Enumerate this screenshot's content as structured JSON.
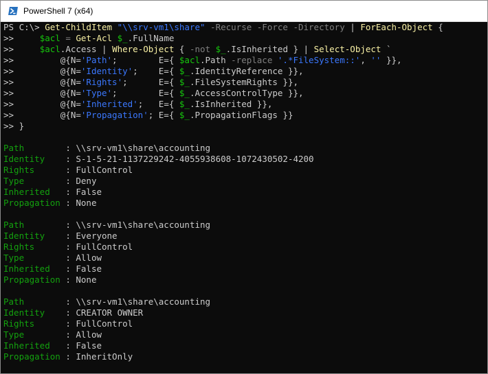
{
  "window": {
    "title": "PowerShell 7 (x64)"
  },
  "icons": {
    "app": "powershell-icon"
  },
  "colors": {
    "background": "#0c0c0c",
    "text": "#cccccc",
    "command": "#f9f1a5",
    "string": "#3b78ff",
    "variable": "#16c60c",
    "parameter": "#808080",
    "label": "#13a10e"
  },
  "command_lines": [
    [
      {
        "t": "PS C:\\> ",
        "c": "default"
      },
      {
        "t": "Get-ChildItem ",
        "c": "cmd"
      },
      {
        "t": "\"\\\\srv-vm1\\share\" ",
        "c": "str"
      },
      {
        "t": "-Recurse -Force -Directory ",
        "c": "param"
      },
      {
        "t": "| ",
        "c": "default"
      },
      {
        "t": "ForEach-Object ",
        "c": "cmd"
      },
      {
        "t": "{",
        "c": "default"
      }
    ],
    [
      {
        "t": ">>     ",
        "c": "default"
      },
      {
        "t": "$acl",
        "c": "var"
      },
      {
        "t": " = ",
        "c": "op"
      },
      {
        "t": "Get-Acl ",
        "c": "cmd"
      },
      {
        "t": "$_",
        "c": "var"
      },
      {
        "t": ".FullName",
        "c": "default"
      }
    ],
    [
      {
        "t": ">>     ",
        "c": "default"
      },
      {
        "t": "$acl",
        "c": "var"
      },
      {
        "t": ".Access | ",
        "c": "default"
      },
      {
        "t": "Where-Object ",
        "c": "cmd"
      },
      {
        "t": "{ ",
        "c": "default"
      },
      {
        "t": "-not ",
        "c": "param"
      },
      {
        "t": "$_",
        "c": "var"
      },
      {
        "t": ".IsInherited } | ",
        "c": "default"
      },
      {
        "t": "Select-Object ",
        "c": "cmd"
      },
      {
        "t": "`",
        "c": "default"
      }
    ],
    [
      {
        "t": ">>         @{N=",
        "c": "default"
      },
      {
        "t": "'Path'",
        "c": "str"
      },
      {
        "t": ";        E={ ",
        "c": "default"
      },
      {
        "t": "$acl",
        "c": "var"
      },
      {
        "t": ".Path ",
        "c": "default"
      },
      {
        "t": "-replace ",
        "c": "param"
      },
      {
        "t": "'.*FileSystem::'",
        "c": "str"
      },
      {
        "t": ", ",
        "c": "default"
      },
      {
        "t": "''",
        "c": "str"
      },
      {
        "t": " }},",
        "c": "default"
      }
    ],
    [
      {
        "t": ">>         @{N=",
        "c": "default"
      },
      {
        "t": "'Identity'",
        "c": "str"
      },
      {
        "t": ";    E={ ",
        "c": "default"
      },
      {
        "t": "$_",
        "c": "var"
      },
      {
        "t": ".IdentityReference }},",
        "c": "default"
      }
    ],
    [
      {
        "t": ">>         @{N=",
        "c": "default"
      },
      {
        "t": "'Rights'",
        "c": "str"
      },
      {
        "t": ";      E={ ",
        "c": "default"
      },
      {
        "t": "$_",
        "c": "var"
      },
      {
        "t": ".FileSystemRights }},",
        "c": "default"
      }
    ],
    [
      {
        "t": ">>         @{N=",
        "c": "default"
      },
      {
        "t": "'Type'",
        "c": "str"
      },
      {
        "t": ";        E={ ",
        "c": "default"
      },
      {
        "t": "$_",
        "c": "var"
      },
      {
        "t": ".AccessControlType }},",
        "c": "default"
      }
    ],
    [
      {
        "t": ">>         @{N=",
        "c": "default"
      },
      {
        "t": "'Inherited'",
        "c": "str"
      },
      {
        "t": ";   E={ ",
        "c": "default"
      },
      {
        "t": "$_",
        "c": "var"
      },
      {
        "t": ".IsInherited }},",
        "c": "default"
      }
    ],
    [
      {
        "t": ">>         @{N=",
        "c": "default"
      },
      {
        "t": "'Propagation'",
        "c": "str"
      },
      {
        "t": "; E={ ",
        "c": "default"
      },
      {
        "t": "$_",
        "c": "var"
      },
      {
        "t": ".PropagationFlags }}",
        "c": "default"
      }
    ],
    [
      {
        "t": ">> }",
        "c": "default"
      }
    ]
  ],
  "output_records": [
    [
      {
        "label": "Path",
        "value": "\\\\srv-vm1\\share\\accounting"
      },
      {
        "label": "Identity",
        "value": "S-1-5-21-1137229242-4055938608-1072430502-4200"
      },
      {
        "label": "Rights",
        "value": "FullControl"
      },
      {
        "label": "Type",
        "value": "Deny"
      },
      {
        "label": "Inherited",
        "value": "False"
      },
      {
        "label": "Propagation",
        "value": "None"
      }
    ],
    [
      {
        "label": "Path",
        "value": "\\\\srv-vm1\\share\\accounting"
      },
      {
        "label": "Identity",
        "value": "Everyone"
      },
      {
        "label": "Rights",
        "value": "FullControl"
      },
      {
        "label": "Type",
        "value": "Allow"
      },
      {
        "label": "Inherited",
        "value": "False"
      },
      {
        "label": "Propagation",
        "value": "None"
      }
    ],
    [
      {
        "label": "Path",
        "value": "\\\\srv-vm1\\share\\accounting"
      },
      {
        "label": "Identity",
        "value": "CREATOR OWNER"
      },
      {
        "label": "Rights",
        "value": "FullControl"
      },
      {
        "label": "Type",
        "value": "Allow"
      },
      {
        "label": "Inherited",
        "value": "False"
      },
      {
        "label": "Propagation",
        "value": "InheritOnly"
      }
    ]
  ]
}
